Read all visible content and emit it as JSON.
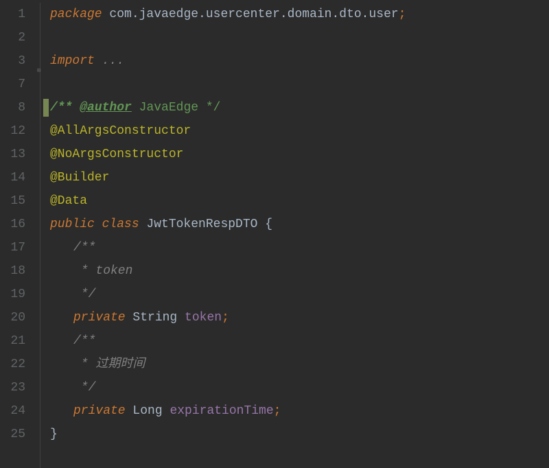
{
  "gutter": {
    "lines": [
      "1",
      "2",
      "3",
      "7",
      "8",
      "12",
      "13",
      "14",
      "15",
      "16",
      "17",
      "18",
      "19",
      "20",
      "21",
      "22",
      "23",
      "24",
      "25"
    ]
  },
  "code": {
    "package_kw": "package",
    "package_name": " com.javaedge.usercenter.domain.dto.user",
    "package_semi": ";",
    "import_kw": "import",
    "import_folded": " ...",
    "javadoc_open": "/** ",
    "javadoc_author_tag": "@author",
    "javadoc_author_val": " JavaEdge ",
    "javadoc_close": "*/",
    "anno_allargs": "@AllArgsConstructor",
    "anno_noargs": "@NoArgsConstructor",
    "anno_builder": "@Builder",
    "anno_data": "@Data",
    "public_kw": "public",
    "class_kw": " class",
    "class_name": " JwtTokenRespDTO ",
    "brace_open": "{",
    "jdoc1_open": "/**",
    "jdoc1_body": " * token",
    "jdoc1_close": " */",
    "private_kw1": "private",
    "type_string": " String ",
    "field_token": "token",
    "semi1": ";",
    "jdoc2_open": "/**",
    "jdoc2_body": " * 过期时间",
    "jdoc2_close": " */",
    "private_kw2": "private",
    "type_long": " Long ",
    "field_exp": "expirationTime",
    "semi2": ";",
    "brace_close": "}"
  }
}
